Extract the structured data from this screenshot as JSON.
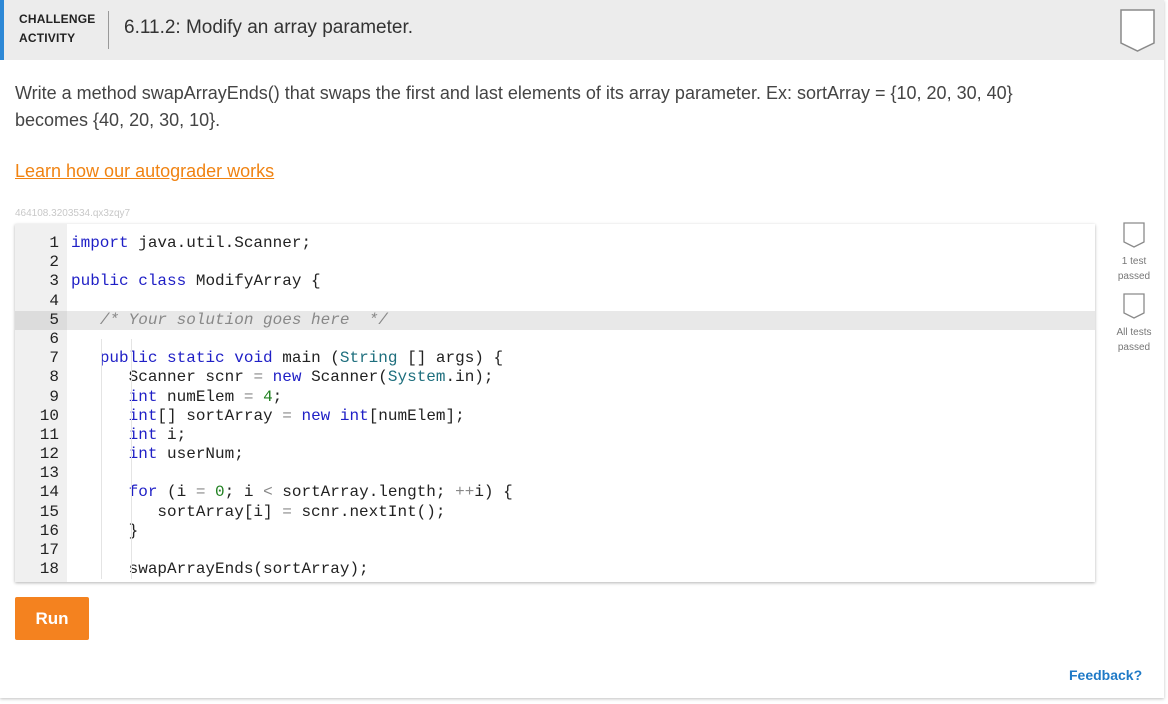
{
  "header": {
    "label_line1": "CHALLENGE",
    "label_line2": "ACTIVITY",
    "title": "6.11.2: Modify an array parameter."
  },
  "description": "Write a method swapArrayEnds() that swaps the first and last elements of its array parameter. Ex: sortArray = {10, 20, 30, 40} becomes {40, 20, 30, 10}.",
  "learn_link": "Learn how our autograder works",
  "challenge_id": "464108.3203534.qx3zqy7",
  "editor": {
    "line_numbers": [
      "1",
      "2",
      "3",
      "4",
      "5",
      "6",
      "7",
      "8",
      "9",
      "10",
      "11",
      "12",
      "13",
      "14",
      "15",
      "16",
      "17",
      "18"
    ],
    "active_line": 5
  },
  "tests": {
    "one_test_line1": "1 test",
    "one_test_line2": "passed",
    "all_tests_line1": "All tests",
    "all_tests_line2": "passed"
  },
  "run_label": "Run",
  "feedback_label": "Feedback?",
  "colors": {
    "accent_blue": "#2d88d6",
    "run_orange": "#f4821f",
    "link_orange": "#f08312",
    "feedback_blue": "#1f7ac7"
  }
}
